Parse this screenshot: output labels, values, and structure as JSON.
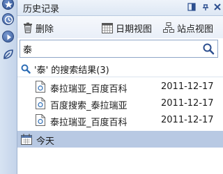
{
  "panel": {
    "title": "历史记录",
    "controls": [
      "pin",
      "float",
      "close"
    ]
  },
  "toolbar": {
    "delete_label": "删除",
    "date_view_label": "日期视图",
    "site_view_label": "站点视图"
  },
  "search": {
    "value": "泰",
    "placeholder": ""
  },
  "results": {
    "header": "'泰' 的搜索结果(3)",
    "items": [
      {
        "title": "泰拉瑞亚_百度百科",
        "date": "2011-12-17"
      },
      {
        "title": "百度搜索_泰拉瑞亚",
        "date": "2011-12-17"
      },
      {
        "title": "泰拉瑞亚_百度百科",
        "date": "2011-12-17"
      }
    ]
  },
  "groups": {
    "today_label": "今天"
  },
  "colors": {
    "accent": "#2d4f8f",
    "selected_row": "#b8c9e3",
    "toolbar_bg": "#e9eff8"
  }
}
